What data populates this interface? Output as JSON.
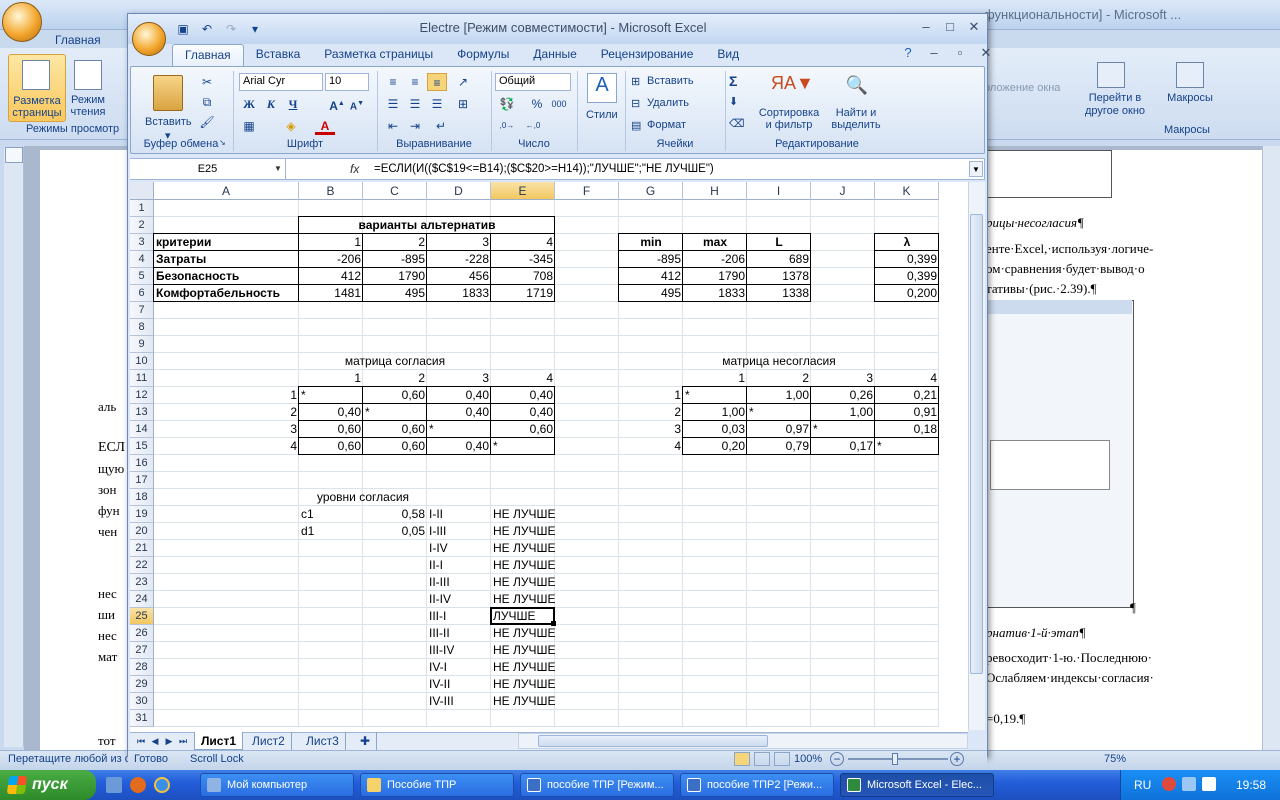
{
  "word": {
    "title_fragment": "функциональности] - Microsoft ...",
    "tab_home": "Главная",
    "views_btn1": "Разметка страницы",
    "views_btn2": "Режим чтения",
    "views_group_label": "Режимы просмотр",
    "right_group_text": "оложение окна",
    "goto_btn": "Перейти в другое окно",
    "macro_btn": "Макросы",
    "macro_group_label": "Макросы",
    "status_text": "Перетащите любой из ограничивающих рисунок маркеров.",
    "zoom": "75%",
    "doc_lines": [
      "рицы·несогласия¶",
      "енте·Excel,·используя·логиче-",
      "ом·сравнения·будет·вывод·о",
      "тативы·(рис.·2.39).¶",
      "¶",
      "рнатив·1-й·этап¶",
      "ревосходит·1-ю.·Последнюю·",
      "Ослабляем·индексы·согласия·",
      "=0,19.¶"
    ],
    "doc_left_lines": [
      "аль",
      "ЕСЛ",
      "щую",
      "зон",
      "фун",
      "чен",
      "нес",
      "ши",
      "нес",
      "мат",
      "тот"
    ]
  },
  "excel": {
    "title": "Electre  [Режим совместимости] - Microsoft Excel",
    "tabs": [
      "Главная",
      "Вставка",
      "Разметка страницы",
      "Формулы",
      "Данные",
      "Рецензирование",
      "Вид"
    ],
    "ribbon": {
      "paste": "Вставить",
      "clipboard_label": "Буфер обмена",
      "font_name": "Arial Cyr",
      "font_size": "10",
      "font_label": "Шрифт",
      "bold": "Ж",
      "italic": "К",
      "underline": "Ч",
      "align_label": "Выравнивание",
      "number_format": "Общий",
      "number_label": "Число",
      "styles": "Стили",
      "insert": "Вставить",
      "delete": "Удалить",
      "format": "Формат",
      "cells_label": "Ячейки",
      "sort": "Сортировка и фильтр",
      "find": "Найти и выделить",
      "editing_label": "Редактирование",
      "sigma": "Σ"
    },
    "name_box": "E25",
    "fx": "fx",
    "formula": "=ЕСЛИ(И(($C$19<=B14);($C$20>=H14));\"ЛУЧШЕ\";\"НЕ ЛУЧШЕ\")",
    "columns": [
      "A",
      "B",
      "C",
      "D",
      "E",
      "F",
      "G",
      "H",
      "I",
      "J",
      "K"
    ],
    "rows": [
      "1",
      "2",
      "3",
      "4",
      "5",
      "6",
      "7",
      "8",
      "9",
      "10",
      "11",
      "12",
      "13",
      "14",
      "15",
      "16",
      "17",
      "18",
      "19",
      "20",
      "21",
      "22",
      "23",
      "24",
      "25",
      "26",
      "27",
      "28",
      "29",
      "30",
      "31"
    ],
    "cells": {
      "alt_header": "варианты альтернатив",
      "criteria": "критерии",
      "alt_nums": [
        "1",
        "2",
        "3",
        "4"
      ],
      "crit_names": [
        "Затраты",
        "Безопасность",
        "Комфортабельность"
      ],
      "crit_values": [
        [
          "-206",
          "-895",
          "-228",
          "-345"
        ],
        [
          "412",
          "1790",
          "456",
          "708"
        ],
        [
          "1481",
          "495",
          "1833",
          "1719"
        ]
      ],
      "stats_headers": [
        "min",
        "max",
        "L",
        "λ"
      ],
      "stats_values": [
        [
          "-895",
          "-206",
          "689",
          "0,399"
        ],
        [
          "412",
          "1790",
          "1378",
          "0,399"
        ],
        [
          "495",
          "1833",
          "1338",
          "0,200"
        ]
      ],
      "agree_title": "матрица согласия",
      "disagree_title": "матрица несогласия",
      "matrix_idx": [
        "1",
        "2",
        "3",
        "4"
      ],
      "agree_matrix": [
        [
          "*",
          "0,60",
          "0,40",
          "0,40"
        ],
        [
          "0,40",
          "*",
          "0,40",
          "0,40"
        ],
        [
          "0,60",
          "0,60",
          "*",
          "0,60"
        ],
        [
          "0,60",
          "0,60",
          "0,40",
          "*"
        ]
      ],
      "disagree_matrix": [
        [
          "*",
          "1,00",
          "0,26",
          "0,21"
        ],
        [
          "1,00",
          "*",
          "1,00",
          "0,91"
        ],
        [
          "0,03",
          "0,97",
          "*",
          "0,18"
        ],
        [
          "0,20",
          "0,79",
          "0,17",
          "*"
        ]
      ],
      "levels_title": "уровни согласия",
      "levels": [
        [
          "c1",
          "0,58"
        ],
        [
          "d1",
          "0,05"
        ]
      ],
      "pairs": [
        "I-II",
        "I-III",
        "I-IV",
        "II-I",
        "II-III",
        "II-IV",
        "III-I",
        "III-II",
        "III-IV",
        "IV-I",
        "IV-II",
        "IV-III"
      ],
      "results": [
        "НЕ ЛУЧШЕ",
        "НЕ ЛУЧШЕ",
        "НЕ ЛУЧШЕ",
        "НЕ ЛУЧШЕ",
        "НЕ ЛУЧШЕ",
        "НЕ ЛУЧШЕ",
        "ЛУЧШЕ",
        "НЕ ЛУЧШЕ",
        "НЕ ЛУЧШЕ",
        "НЕ ЛУЧШЕ",
        "НЕ ЛУЧШЕ",
        "НЕ ЛУЧШЕ"
      ]
    },
    "sheets": [
      "Лист1",
      "Лист2",
      "Лист3"
    ],
    "status_ready": "Готово",
    "status_scroll": "Scroll Lock",
    "zoom": "100%"
  },
  "taskbar": {
    "start": "пуск",
    "buttons": [
      "Мой компьютер",
      "Пособие ТПР",
      "пособие ТПР [Режим...",
      "пособие ТПР2 [Режи...",
      "Microsoft Excel - Elec..."
    ],
    "lang": "RU",
    "clock": "19:58"
  }
}
